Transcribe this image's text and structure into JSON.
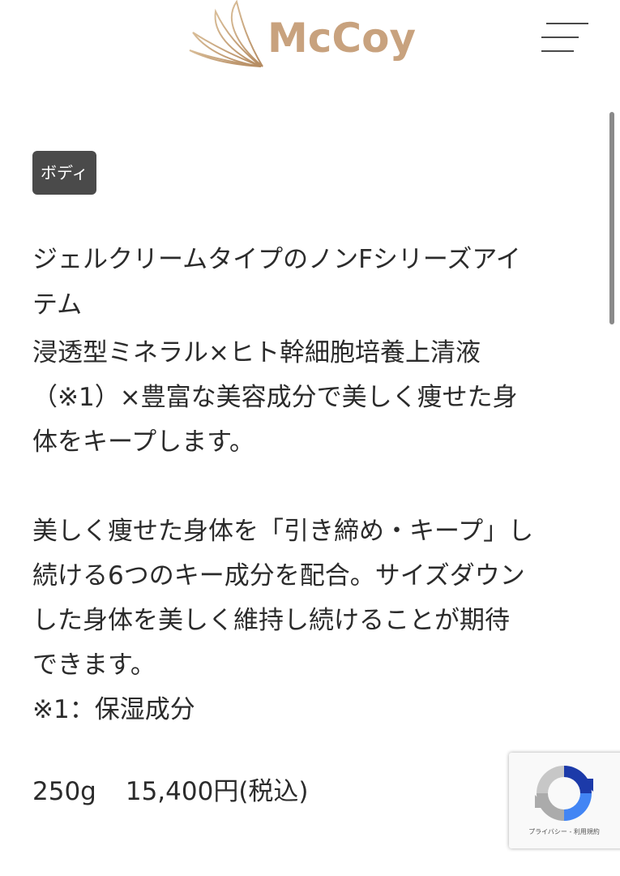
{
  "header": {
    "logo_text": "McCoy",
    "menu_icon": "hamburger-menu-icon"
  },
  "product": {
    "category_badge": "ボディ",
    "title_lines": [
      "ジェルクリームタイプのノンFシリーズアイ",
      "テム"
    ],
    "description_lines": [
      "浸透型ミネラル×ヒト幹細胞培養上清液",
      "（※1）×豊富な美容成分で美しく痩せた身",
      "体をキープします。"
    ],
    "feature_lines": [
      "美しく痩せた身体を「引き締め・キープ」し",
      "続ける6つのキー成分を配合。サイズダウン",
      "した身体を美しく維持し続けることが期待",
      "できます。",
      "※1：保湿成分"
    ],
    "size": "250g",
    "price": "15,400円(税込)"
  },
  "recaptcha": {
    "links_text": "プライバシー - 利用規約"
  },
  "colors": {
    "brand_gold": "#c8a27e",
    "badge_bg": "#4a4a4a",
    "text": "#2b2b2b"
  }
}
